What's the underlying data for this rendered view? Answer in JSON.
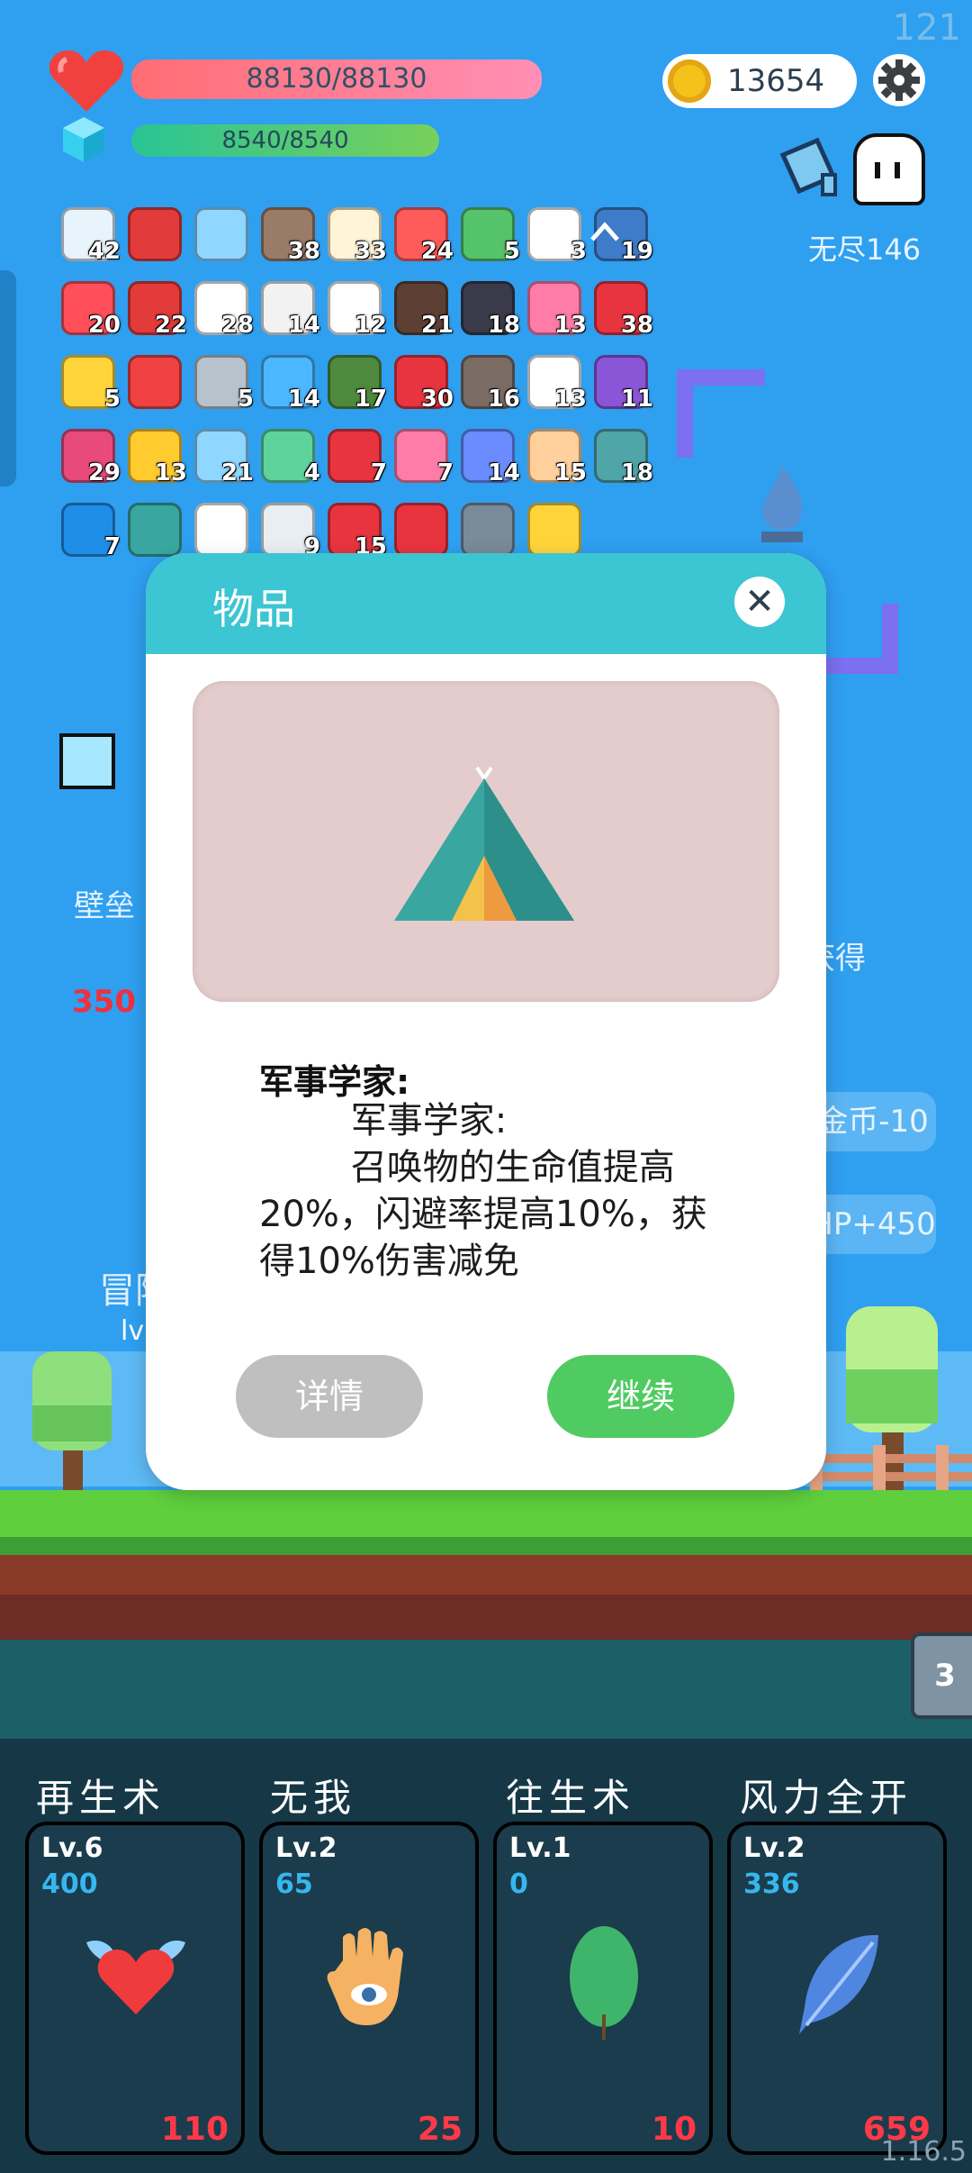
{
  "fps": "121",
  "hp": "88130/88130",
  "mp": "8540/8540",
  "coins": "13654",
  "mode": "无尽146",
  "colors": {
    "accent": "#3cc5d2",
    "continue": "#4fcb61",
    "detail": "#bfbfbf",
    "cost": "#ff3948",
    "value": "#35b7ef"
  },
  "inventory": [
    {
      "icon": "star-card-icon",
      "count": "42",
      "color": "#e8f4fb"
    },
    {
      "icon": "magnet-icon",
      "count": "",
      "color": "#e23b3b"
    },
    {
      "icon": "magnifier-icon",
      "count": "",
      "color": "#8fd7ff"
    },
    {
      "icon": "donut-icon",
      "count": "38",
      "color": "#9a7b68"
    },
    {
      "icon": "fried-egg-icon",
      "count": "33",
      "color": "#fff4d6"
    },
    {
      "icon": "watermelon-icon",
      "count": "24",
      "color": "#ff5b5b"
    },
    {
      "icon": "cash-icon",
      "count": "5",
      "color": "#55c36a"
    },
    {
      "icon": "cloud-icon",
      "count": "3",
      "color": "#ffffff"
    },
    {
      "icon": "shield-icon",
      "count": "19",
      "color": "#3e7bc8"
    },
    {
      "icon": "heart-icon",
      "count": "20",
      "color": "#ff4f59"
    },
    {
      "icon": "strawberry-icon",
      "count": "22",
      "color": "#e33a3a"
    },
    {
      "icon": "flower-icon",
      "count": "28",
      "color": "#ffffff"
    },
    {
      "icon": "cloud-shell-icon",
      "count": "14",
      "color": "#f2f2f2"
    },
    {
      "icon": "playing-card-icon",
      "count": "12",
      "color": "#ffffff"
    },
    {
      "icon": "coconut-icon",
      "count": "21",
      "color": "#5d4033"
    },
    {
      "icon": "bomb-icon",
      "count": "18",
      "color": "#3a3a4a"
    },
    {
      "icon": "ice-cream-icon",
      "count": "13",
      "color": "#ff7ca8"
    },
    {
      "icon": "apple-icon",
      "count": "38",
      "color": "#e8343f"
    },
    {
      "icon": "gold-orb-icon",
      "count": "5",
      "color": "#ffd43b"
    },
    {
      "icon": "percent-tag-icon",
      "count": "",
      "color": "#ef4141"
    },
    {
      "icon": "sword-icon",
      "count": "5",
      "color": "#b8c2cc"
    },
    {
      "icon": "speech-bubble-icon",
      "count": "14",
      "color": "#4bb7ff"
    },
    {
      "icon": "grenade-icon",
      "count": "17",
      "color": "#4e8a3d"
    },
    {
      "icon": "sock-icon",
      "count": "30",
      "color": "#e8343f"
    },
    {
      "icon": "tombstone-icon",
      "count": "16",
      "color": "#7a6b63"
    },
    {
      "icon": "clipboard-icon",
      "count": "13",
      "color": "#ffffff"
    },
    {
      "icon": "purple-shield-icon",
      "count": "11",
      "color": "#8a55d6"
    },
    {
      "icon": "jam-jar-icon",
      "count": "29",
      "color": "#e84a7c"
    },
    {
      "icon": "sunflower-icon",
      "count": "13",
      "color": "#ffcb2f"
    },
    {
      "icon": "potion-icon",
      "count": "21",
      "color": "#8fd7ff"
    },
    {
      "icon": "green-spirit-icon",
      "count": "4",
      "color": "#5fd39c"
    },
    {
      "icon": "red-shield-icon",
      "count": "7",
      "color": "#e8343f"
    },
    {
      "icon": "spray-bottle-icon",
      "count": "7",
      "color": "#ff7ca8"
    },
    {
      "icon": "pill-icon",
      "count": "14",
      "color": "#6a8cff"
    },
    {
      "icon": "hand-icon",
      "count": "15",
      "color": "#ffcf9c"
    },
    {
      "icon": "ring-icon",
      "count": "18",
      "color": "#4fa5a8"
    },
    {
      "icon": "sapphire-icon",
      "count": "7",
      "color": "#1f8ee8"
    },
    {
      "icon": "tent-icon",
      "count": "",
      "color": "#3aa6a0"
    },
    {
      "icon": "noose-icon",
      "count": "",
      "color": "#ffffff"
    },
    {
      "icon": "lightbulb-icon",
      "count": "9",
      "color": "#e9eef2"
    },
    {
      "icon": "capsule-icon",
      "count": "15",
      "color": "#e8343f"
    },
    {
      "icon": "heart-small-icon",
      "count": "",
      "color": "#e8343f"
    },
    {
      "icon": "axe-icon",
      "count": "",
      "color": "#7a8a99"
    },
    {
      "icon": "crown-icon",
      "count": "",
      "color": "#ffd43b"
    }
  ],
  "background": {
    "wall": "壁垒",
    "number_350": "350",
    "get": "获得",
    "coin_minus": "金币-10",
    "hp_plus": "HP+450",
    "adventure": "冒险",
    "lv": "lv"
  },
  "badge": "3",
  "dialog": {
    "title": "物品",
    "close": "✕",
    "item_name": "军事学家:",
    "item_desc": "        军事学家:\n        召唤物的生命值提高20%，闪避率提高10%，获得10%伤害减免",
    "detail_btn": "详情",
    "continue_btn": "继续"
  },
  "skills": [
    {
      "name": "再生术",
      "level": "Lv.6",
      "value": "400",
      "cost": "110",
      "icon": "winged-heart-icon"
    },
    {
      "name": "无我",
      "level": "Lv.2",
      "value": "65",
      "cost": "25",
      "icon": "hamsa-eye-icon"
    },
    {
      "name": "往生术",
      "level": "Lv.1",
      "value": "0",
      "cost": "10",
      "icon": "leaf-icon"
    },
    {
      "name": "风力全开",
      "level": "Lv.2",
      "value": "336",
      "cost": "659",
      "icon": "feather-icon"
    }
  ],
  "version": "1.16.5"
}
